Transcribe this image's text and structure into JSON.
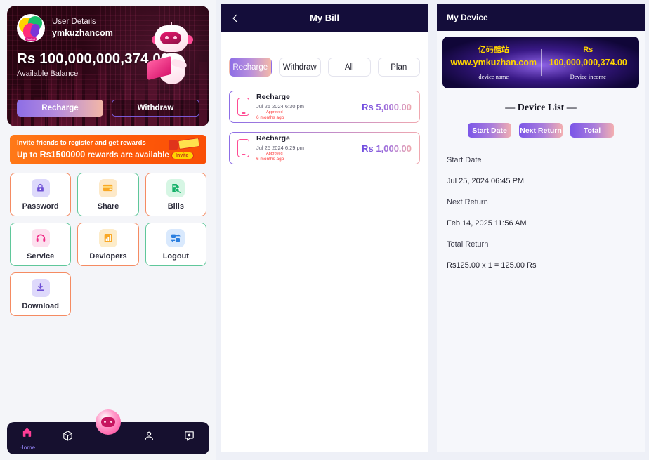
{
  "home": {
    "user": {
      "label": "User Details",
      "name": "ymkuzhancom",
      "avatar_icon": "wallet-logo-icon"
    },
    "balance": "Rs 100,000,000,374.00",
    "balance_caption": "Available Balance",
    "recharge_label": "Recharge",
    "withdraw_label": "Withdraw",
    "mascot_icon": "robot-mascot-icon",
    "invite": {
      "line1": "Invite friends to register and get rewards",
      "line2_prefix": "Up to ",
      "line2_amount": "Rs1500000",
      "line2_suffix": " rewards are available",
      "badge_label": "Invite"
    },
    "features": [
      {
        "label": "Password",
        "icon": "lock-icon",
        "border": "orange"
      },
      {
        "label": "Share",
        "icon": "card-icon",
        "border": "green"
      },
      {
        "label": "Bills",
        "icon": "bill-search-icon",
        "border": "orange"
      },
      {
        "label": "Service",
        "icon": "headset-icon",
        "border": "green"
      },
      {
        "label": "Devlopers",
        "icon": "chart-building-icon",
        "border": "orange"
      },
      {
        "label": "Logout",
        "icon": "swap-icon",
        "border": "green"
      },
      {
        "label": "Download",
        "icon": "download-icon",
        "border": "orange"
      }
    ],
    "nav": [
      {
        "label": "Home",
        "icon": "home-icon",
        "active": true
      },
      {
        "label": "",
        "icon": "cube-icon",
        "active": false
      },
      {
        "label": "",
        "icon": "robot-icon",
        "active": false
      },
      {
        "label": "",
        "icon": "user-icon",
        "active": false
      },
      {
        "label": "",
        "icon": "chat-icon",
        "active": false
      }
    ]
  },
  "bill": {
    "header_title": "My Bill",
    "back_icon": "chevron-left-icon",
    "tabs": [
      {
        "label": "Recharge",
        "active": true
      },
      {
        "label": "Withdraw",
        "active": false
      },
      {
        "label": "All",
        "active": false
      },
      {
        "label": "Plan",
        "active": false
      }
    ],
    "items": [
      {
        "title": "Recharge",
        "date": "Jul 25 2024 6:30:pm",
        "status": "Approved",
        "ago": "6 months ago",
        "amount": "Rs 5,000.00",
        "icon": "mobile-icon"
      },
      {
        "title": "Recharge",
        "date": "Jul 25 2024 6:29:pm",
        "status": "Approved",
        "ago": "6 months ago",
        "amount": "Rs 1,000.00",
        "icon": "mobile-icon"
      }
    ]
  },
  "device": {
    "header_title": "My Device",
    "banner": {
      "name_cn": "亿码酷站",
      "name_url": "www.ymkuzhan.com",
      "name_caption": "device name",
      "income_currency": "Rs",
      "income_value": "100,000,000,374.00",
      "income_caption": "Device income"
    },
    "list_title": "— Device List —",
    "tabs": [
      {
        "label": "Start Date"
      },
      {
        "label": "Next Return"
      },
      {
        "label": "Total"
      }
    ],
    "rows": [
      {
        "key": "Start Date",
        "value": "Jul 25, 2024 06:45 PM"
      },
      {
        "key": "Next Return",
        "value": "Feb 14, 2025 11:56 AM"
      },
      {
        "key": "Total Return",
        "value": "Rs125.00 x 1 = 125.00 Rs"
      }
    ]
  },
  "colors": {
    "accent_purple": "#8d6ee6",
    "accent_pink": "#f3b7a6",
    "dark_navy": "#140d3a",
    "orange_banner": "#ff5a0a",
    "gold": "#ffd400"
  }
}
